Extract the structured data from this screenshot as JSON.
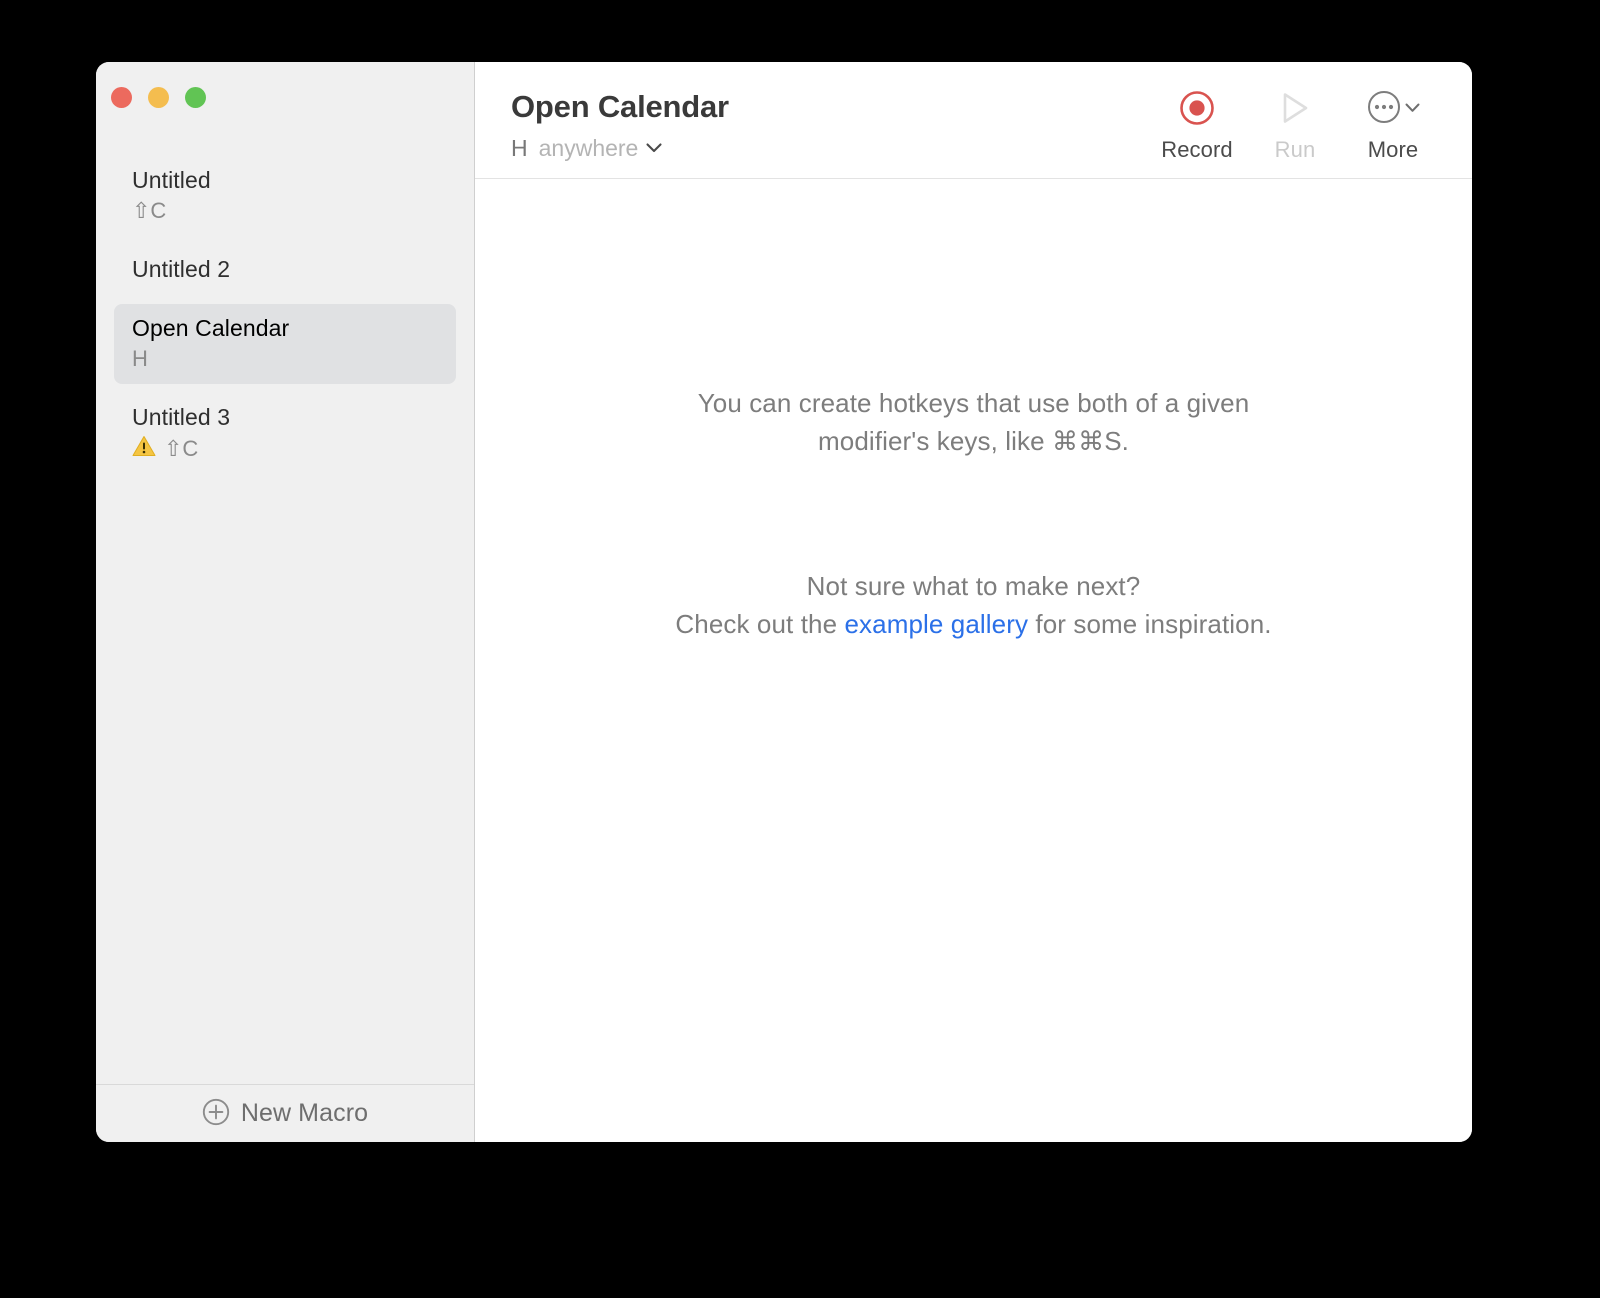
{
  "window": {
    "traffic_lights": [
      {
        "name": "close",
        "color": "#ec6a5e"
      },
      {
        "name": "minimize",
        "color": "#f4bd4f"
      },
      {
        "name": "maximize",
        "color": "#61c454"
      }
    ]
  },
  "sidebar": {
    "macros": [
      {
        "title": "Untitled",
        "shortcut": "⇧C",
        "warning": false,
        "selected": false
      },
      {
        "title": "Untitled 2",
        "shortcut": "",
        "warning": false,
        "selected": false
      },
      {
        "title": "Open Calendar",
        "shortcut": "H",
        "warning": false,
        "selected": true
      },
      {
        "title": "Untitled 3",
        "shortcut": "⇧C",
        "warning": true,
        "selected": false
      }
    ],
    "footer": {
      "new_macro_label": "New Macro",
      "new_macro_icon": "plus-circle-icon"
    }
  },
  "header": {
    "macro_name": "Open Calendar",
    "trigger_key": "H",
    "trigger_scope": "anywhere",
    "trigger_scope_chevron": "chevron-down-icon",
    "toolbar": [
      {
        "label": "Record",
        "icon": "record-icon",
        "disabled": false
      },
      {
        "label": "Run",
        "icon": "play-icon",
        "disabled": true
      },
      {
        "label": "More",
        "icon": "ellipsis-circle-icon",
        "disabled": false
      }
    ]
  },
  "empty_state": {
    "tip_line1": "You can create hotkeys that use both of a given",
    "tip_line2": "modifier's keys, like ⌘⌘S.",
    "gallery_line1": "Not sure what to make next?",
    "gallery_prefix": "Check out the ",
    "gallery_link": "example gallery",
    "gallery_suffix": " for some inspiration."
  },
  "colors": {
    "accent_link": "#2b70e8",
    "record_red": "#d9534f",
    "warning_yellow": "#f5c542",
    "sidebar_bg": "#f0f0f0",
    "selected_row": "#e0e1e3"
  }
}
